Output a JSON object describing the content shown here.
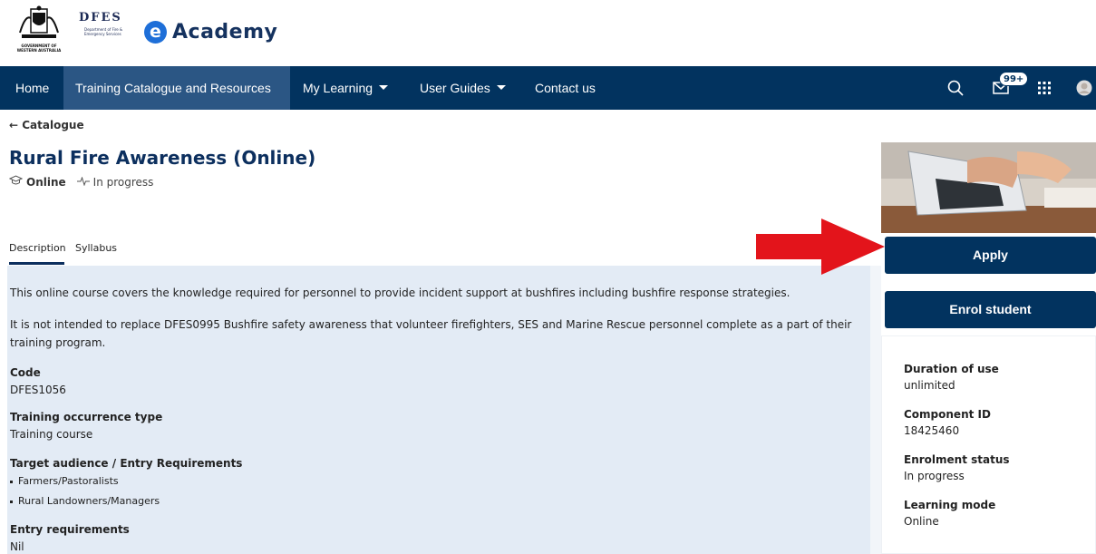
{
  "header": {
    "gov_crest_text": "GOVERNMENT OF WESTERN AUSTRALIA",
    "dfes_logo_text": "DFES",
    "dfes_logo_subtext": "Department of Fire & Emergency Services",
    "app_logo_letter": "e",
    "app_logo_text": "Academy"
  },
  "nav": {
    "items": [
      {
        "label": "Home"
      },
      {
        "label": "Training Catalogue and Resources"
      },
      {
        "label": "My Learning"
      },
      {
        "label": "User Guides"
      },
      {
        "label": "Contact us"
      }
    ],
    "icons": [
      "search-icon",
      "mail-icon",
      "apps-grid-icon",
      "avatar"
    ],
    "mail_badge": "99+"
  },
  "page": {
    "back_link": "← Catalogue",
    "title": "Rural Fire Awareness (Online)",
    "mode": "Online",
    "status": "In progress",
    "tabs": [
      {
        "label": "Description"
      },
      {
        "label": "Syllabus"
      }
    ]
  },
  "description": {
    "para1": "This online course covers the knowledge required for personnel to provide incident support at bushfires including bushfire response strategies.",
    "para2": "It is not intended to replace DFES0995 Bushfire safety awareness that volunteer firefighters, SES and Marine Rescue personnel complete as a part of their training program.",
    "code_label": "Code",
    "code_value": "DFES1056",
    "occurrence_label": "Training occurrence type",
    "occurrence_value": "Training course",
    "audience_label": "Target audience / Entry Requirements",
    "audience_items": [
      "Farmers/Pastoralists",
      "Rural Landowners/Managers"
    ],
    "entry_label": "Entry requirements",
    "entry_value": "Nil"
  },
  "sidebar": {
    "apply_label": "Apply",
    "enrol_label": "Enrol student",
    "details": [
      {
        "label": "Duration of use",
        "value": "unlimited"
      },
      {
        "label": "Component ID",
        "value": "18425460"
      },
      {
        "label": "Enrolment status",
        "value": "In progress"
      },
      {
        "label": "Learning mode",
        "value": "Online"
      }
    ]
  },
  "colors": {
    "nav_bg": "#02335f",
    "nav_active": "#2b5684",
    "content_bg": "#e3ebf5",
    "title": "#0c2f5e",
    "arrow": "#e3141b",
    "logo_blue": "#1e6fd8"
  }
}
